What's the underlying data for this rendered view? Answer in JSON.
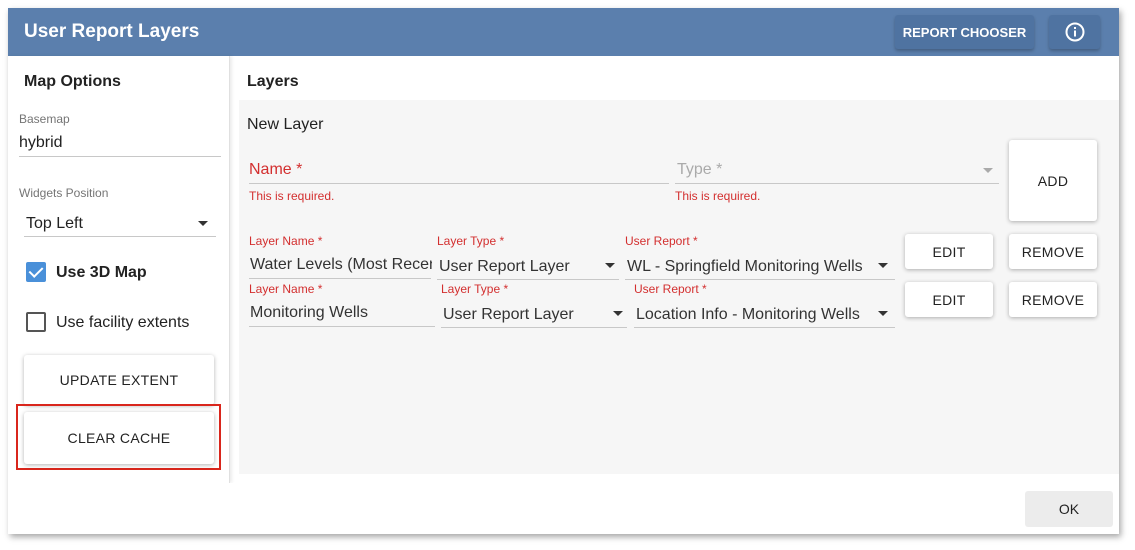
{
  "header": {
    "title": "User Report Layers",
    "report_chooser_label": "REPORT CHOOSER",
    "info_icon": "info-icon"
  },
  "sidebar": {
    "title": "Map Options",
    "basemap": {
      "label": "Basemap",
      "value": "hybrid"
    },
    "widgets_position": {
      "label": "Widgets Position",
      "value": "Top Left"
    },
    "use_3d_map": {
      "label": "Use 3D Map",
      "checked": true
    },
    "use_facility_extents": {
      "label": "Use facility extents",
      "checked": false
    },
    "update_extent_label": "UPDATE EXTENT",
    "clear_cache_label": "CLEAR CACHE"
  },
  "main": {
    "title": "Layers",
    "new_layer": {
      "heading": "New Layer",
      "name_label": "Name",
      "name_error": "This is required.",
      "type_label": "Type",
      "type_error": "This is required.",
      "add_label": "ADD"
    },
    "layers": [
      {
        "layer_name_label": "Layer Name",
        "layer_name": "Water Levels (Most Recent)",
        "layer_type_label": "Layer Type",
        "layer_type": "User Report Layer",
        "user_report_label": "User Report",
        "user_report": "WL - Springfield Monitoring Wells",
        "edit_label": "EDIT",
        "remove_label": "REMOVE"
      },
      {
        "layer_name_label": "Layer Name",
        "layer_name": "Monitoring Wells",
        "layer_type_label": "Layer Type",
        "layer_type": "User Report Layer",
        "user_report_label": "User Report",
        "user_report": "Location Info - Monitoring Wells",
        "edit_label": "EDIT",
        "remove_label": "REMOVE"
      }
    ]
  },
  "footer": {
    "ok_label": "OK"
  },
  "colors": {
    "header": "#5b7fad",
    "required": "#d32f2f",
    "checkbox": "#4a90d9",
    "highlight": "#d9261c"
  }
}
